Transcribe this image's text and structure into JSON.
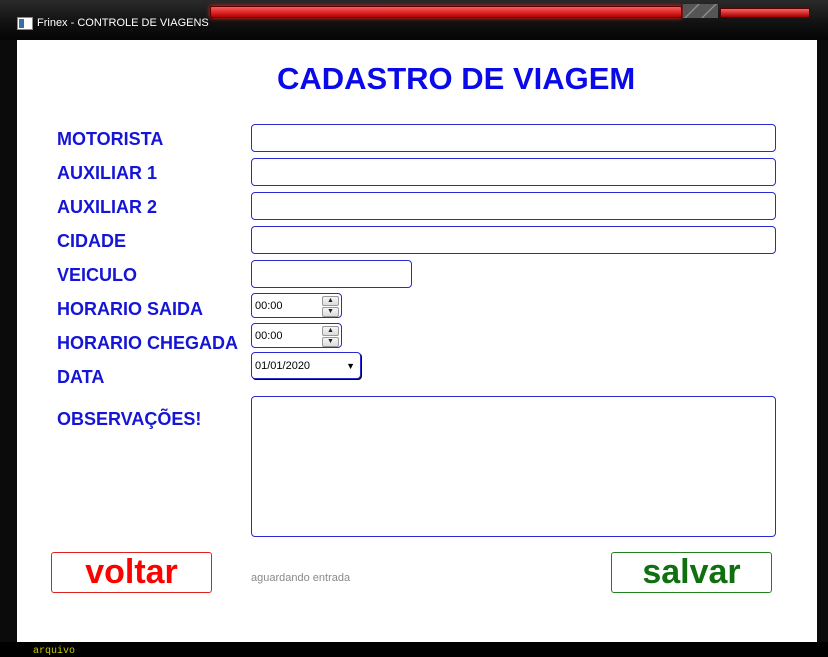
{
  "window": {
    "title": "Frinex - CONTROLE DE VIAGENS"
  },
  "form": {
    "title": "CADASTRO DE VIAGEM",
    "labels": {
      "motorista": "MOTORISTA",
      "auxiliar1": "AUXILIAR 1",
      "auxiliar2": "AUXILIAR 2",
      "cidade": "CIDADE",
      "veiculo": "VEICULO",
      "horario_saida": "HORARIO SAIDA",
      "horario_chegada": "HORARIO CHEGADA",
      "data": "DATA",
      "observacoes": "OBSERVAÇÕES!"
    },
    "values": {
      "motorista": "",
      "auxiliar1": "",
      "auxiliar2": "",
      "cidade": "",
      "veiculo": "",
      "horario_saida": "00:00",
      "horario_chegada": "00:00",
      "data": "01/01/2020",
      "observacoes": ""
    }
  },
  "status_text": "aguardando entrada",
  "buttons": {
    "voltar": "voltar",
    "salvar": "salvar"
  },
  "bottom_text": "arquivo"
}
